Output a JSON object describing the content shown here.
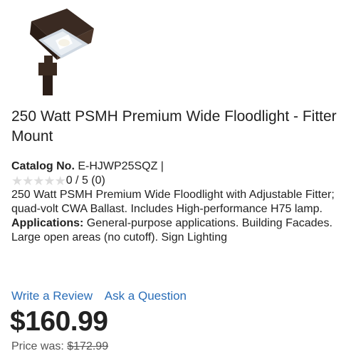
{
  "product": {
    "title": "250 Watt PSMH Premium Wide Floodlight - Fitter Mount",
    "image_icon": "floodlight-fixture",
    "catalog_label": "Catalog No.",
    "catalog_value": "E-HJWP25SQZ |",
    "rating": {
      "stars_filled": 0,
      "stars_total": 5,
      "text": "0 / 5 (0)"
    },
    "description": "250 Watt PSMH Premium Wide Floodlight with Adjustable Fitter; quad-volt CWA Ballast. Includes High-performance H75 lamp.",
    "applications_label": "Applications:",
    "applications_text": "General-purpose applications. Building Facades. Large open areas (no cutoff). Sign Lighting"
  },
  "actions": {
    "write_review": "Write a Review",
    "ask_question": "Ask a Question"
  },
  "pricing": {
    "price": "$160.99",
    "was_label": "Price was:",
    "was_value": "$172.99"
  },
  "colors": {
    "link": "#2a6eb8",
    "star_empty": "#dcdcdc",
    "text": "#222222"
  }
}
